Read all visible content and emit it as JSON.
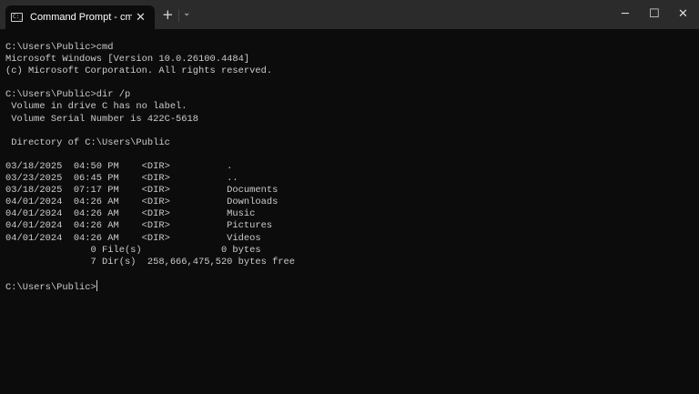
{
  "tab": {
    "title": "Command Prompt - cmd - cmd",
    "icon": "terminal-icon"
  },
  "window_controls": {
    "minimize": "─",
    "maximize": "☐",
    "close": "✕",
    "new_tab": "+",
    "dropdown": "⌄",
    "tab_close": "✕"
  },
  "terminal": {
    "lines": [
      "C:\\Users\\Public>cmd",
      "Microsoft Windows [Version 10.0.26100.4484]",
      "(c) Microsoft Corporation. All rights reserved.",
      "",
      "C:\\Users\\Public>dir /p",
      " Volume in drive C has no label.",
      " Volume Serial Number is 422C-5618",
      "",
      " Directory of C:\\Users\\Public",
      "",
      "03/18/2025  04:50 PM    <DIR>          .",
      "03/23/2025  06:45 PM    <DIR>          ..",
      "03/18/2025  07:17 PM    <DIR>          Documents",
      "04/01/2024  04:26 AM    <DIR>          Downloads",
      "04/01/2024  04:26 AM    <DIR>          Music",
      "04/01/2024  04:26 AM    <DIR>          Pictures",
      "04/01/2024  04:26 AM    <DIR>          Videos",
      "               0 File(s)              0 bytes",
      "               7 Dir(s)  258,666,475,520 bytes free",
      ""
    ],
    "prompt": "C:\\Users\\Public>"
  }
}
